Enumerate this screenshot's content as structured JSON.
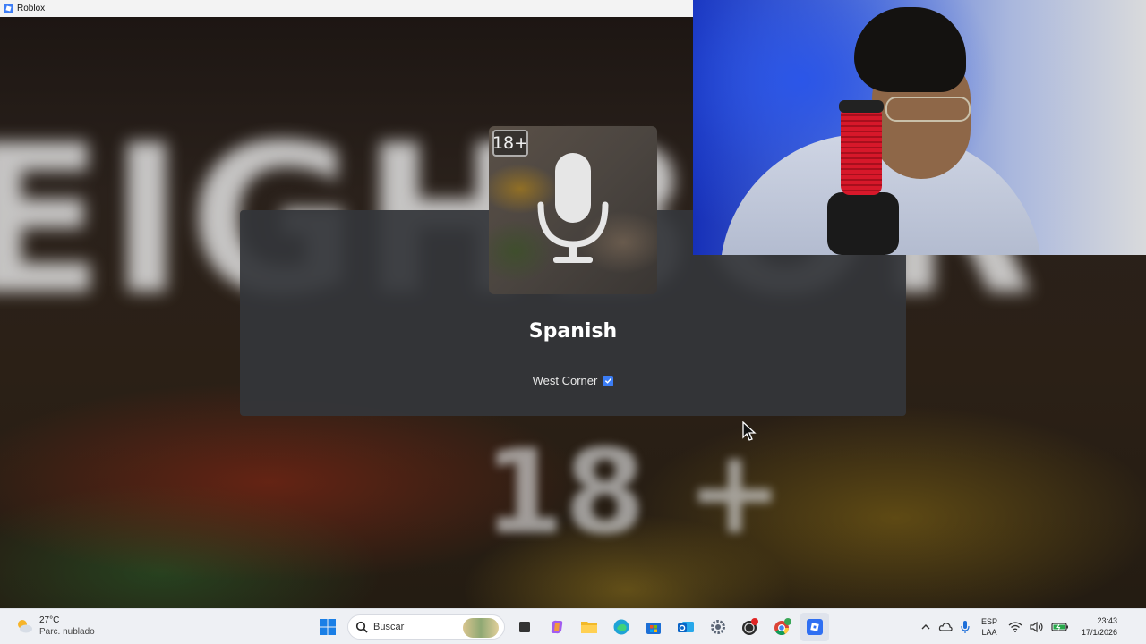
{
  "window": {
    "title": "Roblox"
  },
  "background": {
    "big_text": "EIGHBOR",
    "age_text": "18 +"
  },
  "dialog": {
    "badge": "18+",
    "game_name": "Spanish",
    "creator": "West Corner"
  },
  "taskbar": {
    "weather": {
      "temp": "27°C",
      "desc": "Parc. nublado"
    },
    "search_placeholder": "Buscar",
    "pinned": [
      "start-icon",
      "search-icon",
      "task-view-icon",
      "copilot-icon",
      "file-explorer-icon",
      "edge-icon",
      "microsoft-store-icon",
      "outlook-icon",
      "settings-icon",
      "obs-icon",
      "chrome-icon",
      "roblox-icon"
    ],
    "tray": {
      "lang_line1": "ESP",
      "lang_line2": "LAA",
      "time": "23:43",
      "date": "17/1/2026"
    }
  },
  "colors": {
    "accent": "#3b7df6",
    "dialog_bg": "#34363a",
    "taskbar_bg": "#eef0f4"
  }
}
